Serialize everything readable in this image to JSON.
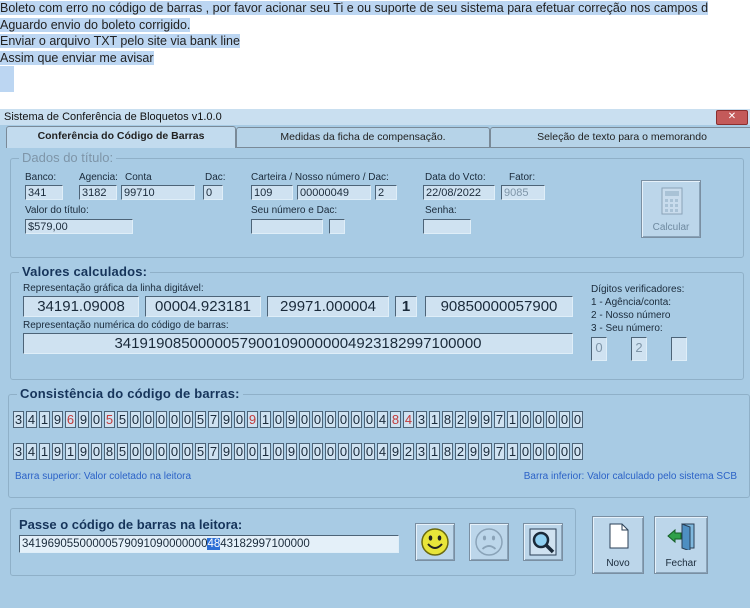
{
  "message": {
    "lines": [
      "Boleto com erro no código de barras , por favor acionar seu Ti e ou suporte de seu sistema para efetuar correção nos campos d",
      "Aguardo envio do boleto corrigido.",
      "Enviar o arquivo TXT pelo site via bank line",
      "Assim que enviar me avisar"
    ]
  },
  "window": {
    "title": "Sistema de Conferência de Bloquetos v1.0.0",
    "close_label": "✕"
  },
  "tabs": [
    {
      "label": "Conferência do Código de Barras",
      "active": true
    },
    {
      "label": "Medidas da ficha de compensação.",
      "active": false
    },
    {
      "label": "Seleção de texto para o memorando",
      "active": false
    }
  ],
  "dados": {
    "title": "Dados do título:",
    "labels": {
      "banco": "Banco:",
      "agencia": "Agencia:",
      "conta": "Conta",
      "dac": "Dac:",
      "carteira": "Carteira / Nosso número / Dac:",
      "data_vcto": "Data do Vcto:",
      "fator": "Fator:",
      "valor": "Valor do título:",
      "seu_numero": "Seu número e  Dac:",
      "senha": "Senha:"
    },
    "values": {
      "banco": "341",
      "agencia": "3182",
      "conta": "99710",
      "dac": "0",
      "carteira": "109",
      "nosso_numero": "00000049",
      "nosso_dac": "2",
      "data_vcto": "22/08/2022",
      "fator": "9085",
      "valor": "$579,00",
      "seu_numero": "",
      "seu_dac": "",
      "senha": ""
    },
    "calcular_label": "Calcular"
  },
  "valores": {
    "title": "Valores calculados:",
    "linha_label": "Representação gráfica da linha digitável:",
    "linha": [
      "34191.09008",
      "00004.923181",
      "29971.000004",
      "1",
      "90850000057900"
    ],
    "numerica_label": "Representação numérica do código de barras:",
    "numerica": "34191908500000579001090000004923182997100000",
    "digitos": {
      "title": "Dígitos verificadores:",
      "items": [
        "1 - Agência/conta:",
        "2 - Nosso número",
        "3 - Seu número:"
      ],
      "values": [
        "0",
        "2",
        ""
      ]
    }
  },
  "consistencia": {
    "title": "Consistência do código de barras:",
    "top": "34196905500000579091090000004843182997100000",
    "bottom": "34191908500000579001090000004923182997100000",
    "note_top": "Barra superior:  Valor coletado na leitora",
    "note_bottom": "Barra inferior: Valor calculado pelo sistema SCB",
    "mismatch_color": "#c23b3b"
  },
  "leitora": {
    "title": "Passe o código de barras na leitora:",
    "input_before": "34196905500000579091090000000",
    "input_selected": "48",
    "input_after": "43182997100000"
  },
  "buttons": {
    "novo": "Novo",
    "fechar": "Fechar"
  }
}
